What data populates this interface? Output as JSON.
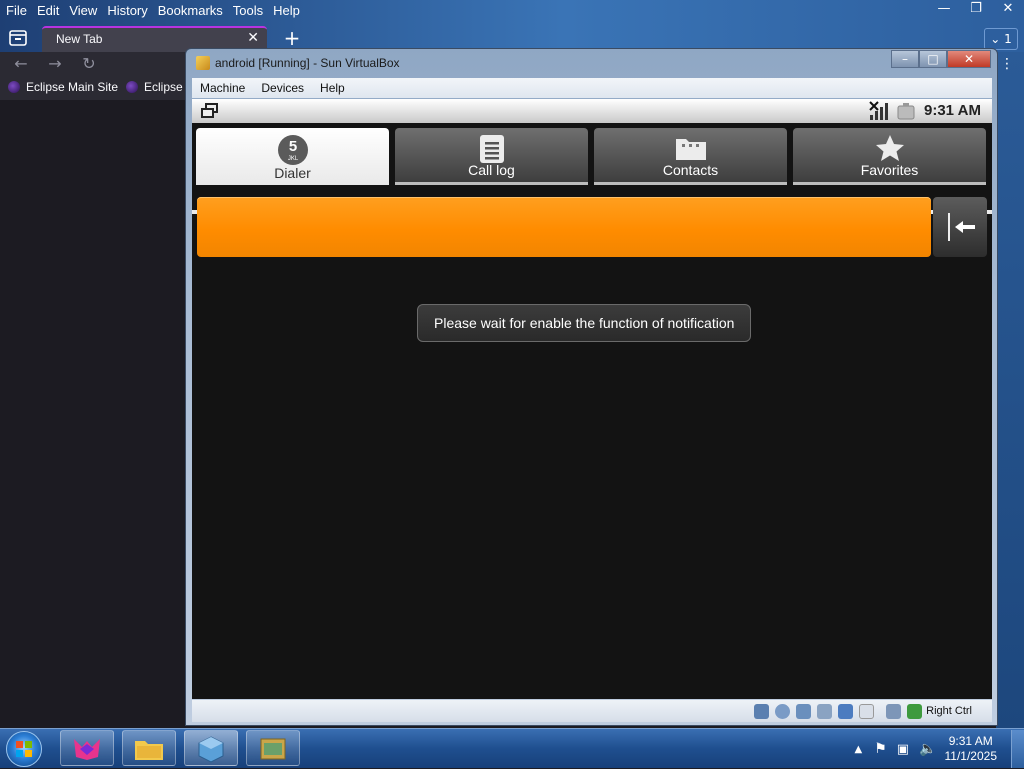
{
  "firefox": {
    "menu": [
      "File",
      "Edit",
      "View",
      "History",
      "Bookmarks",
      "Tools",
      "Help"
    ],
    "tab": {
      "title": "New Tab"
    },
    "tabs_count": "1",
    "bookmarks": [
      "Eclipse Main Site",
      "Eclipse"
    ]
  },
  "virtualbox": {
    "window_title": "android [Running] - Sun VirtualBox",
    "menu": [
      "Machine",
      "Devices",
      "Help"
    ],
    "host_key": "Right Ctrl"
  },
  "android": {
    "status_time": "9:31 AM",
    "tabs": [
      {
        "label": "Dialer",
        "icon": "dialpad-5-icon",
        "selected": true
      },
      {
        "label": "Call log",
        "icon": "call-log-icon",
        "selected": false
      },
      {
        "label": "Contacts",
        "icon": "contacts-folder-icon",
        "selected": false
      },
      {
        "label": "Favorites",
        "icon": "star-icon",
        "selected": false
      }
    ],
    "dialpad_icon_digit": "5",
    "dialpad_icon_letters": "JKL",
    "digits_field_value": "",
    "accent_color": "#ff8c00",
    "toast": "Please wait for enable the function of notification"
  },
  "taskbar": {
    "apps": [
      "firefox-icon",
      "file-explorer-icon",
      "virtualbox-icon",
      "android-window-icon"
    ],
    "clock_time": "9:31 AM",
    "clock_date": "11/1/2025"
  }
}
